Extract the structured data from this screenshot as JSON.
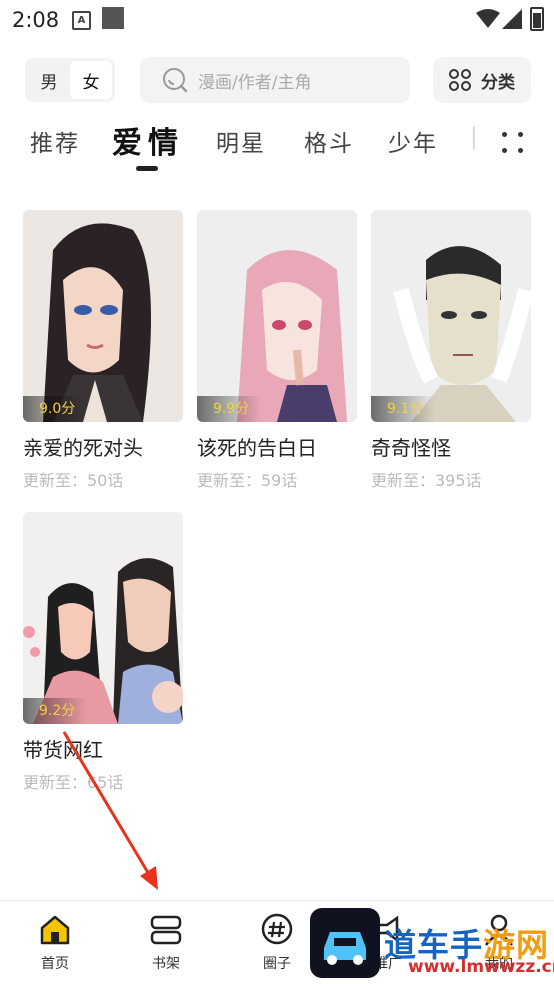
{
  "status": {
    "time": "2:08",
    "a_label": "A"
  },
  "header": {
    "gender": [
      "男",
      "女"
    ],
    "gender_selected": "女",
    "search_placeholder": "漫画/作者/主角",
    "category_label": "分类"
  },
  "tabs": [
    "推荐",
    "爱情",
    "明星",
    "格斗",
    "少年",
    "|"
  ],
  "tabs_active": "爱情",
  "comics": [
    {
      "title": "亲爱的死对头",
      "score": "9.0分",
      "update": "更新至：50话"
    },
    {
      "title": "该死的告白日",
      "score": "9.9分",
      "update": "更新至：59话"
    },
    {
      "title": "奇奇怪怪",
      "score": "9.1分",
      "update": "更新至：395话"
    },
    {
      "title": "带货网红",
      "score": "9.2分",
      "update": "更新至：65话"
    }
  ],
  "bottom_nav": [
    {
      "label": "首页",
      "icon": "home-icon"
    },
    {
      "label": "书架",
      "icon": "bookshelf-icon"
    },
    {
      "label": "圈子",
      "icon": "hashtag-icon"
    },
    {
      "label": "推广",
      "icon": "megaphone-icon"
    },
    {
      "label": "我的",
      "icon": "profile-icon"
    }
  ],
  "watermark": {
    "text_blue": "道车手",
    "text_orange": "游网",
    "url": "www.lmwwzz.cn"
  },
  "colors": {
    "score": "#f4d03f",
    "home_active": "#f5c400",
    "arrow": "#e8321c"
  }
}
